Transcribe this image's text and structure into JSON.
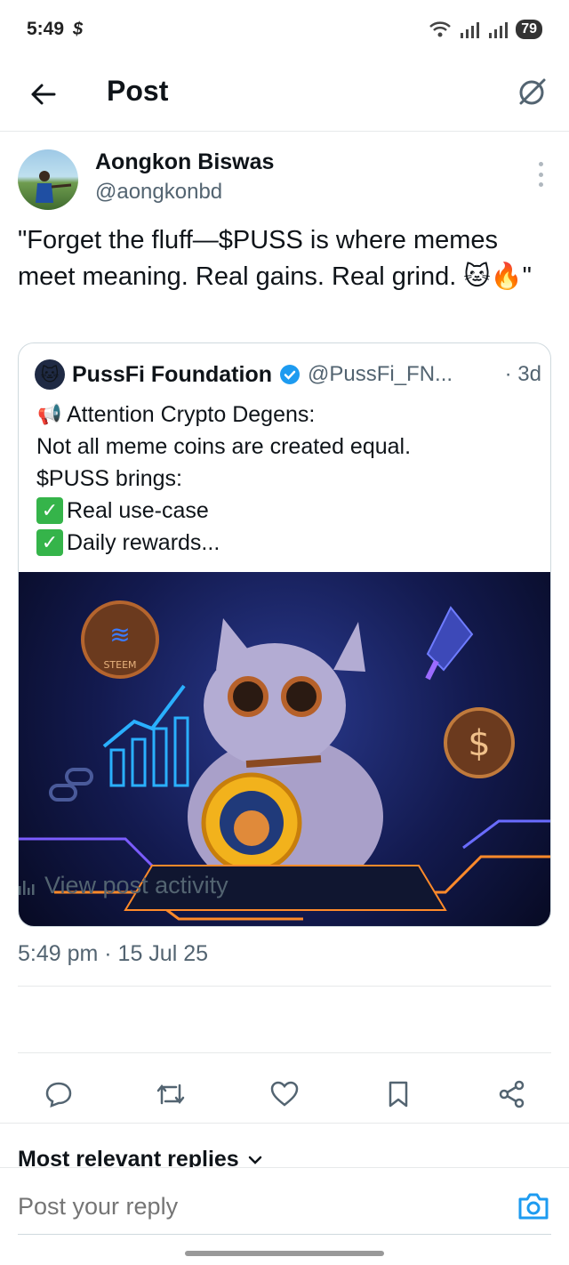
{
  "status_bar": {
    "time": "5:49",
    "battery": "79"
  },
  "header": {
    "title": "Post"
  },
  "post": {
    "author_name": "Aongkon Biswas",
    "author_handle": "@aongkonbd",
    "text": "\"Forget the fluff—$PUSS is where memes meet meaning. Real gains. Real grind. 🐱🔥\"",
    "timestamp": "5:49 pm · 15 Jul 25"
  },
  "quote": {
    "name": "PussFi Foundation",
    "handle": "@PussFi_FN...",
    "time": "· 3d",
    "lines": [
      "Attention Crypto Degens:",
      "Not all meme coins are created equal.",
      "$PUSS brings:",
      "Real use-case",
      "Daily rewards..."
    ],
    "media_coin_label": "STEEM"
  },
  "activity": {
    "label": "View post activity"
  },
  "replies": {
    "title": "Most relevant replies"
  },
  "reply_bar": {
    "placeholder": "Post your reply"
  },
  "colors": {
    "accent": "#1d9bf0",
    "text": "#0f1419",
    "muted": "#536471"
  }
}
